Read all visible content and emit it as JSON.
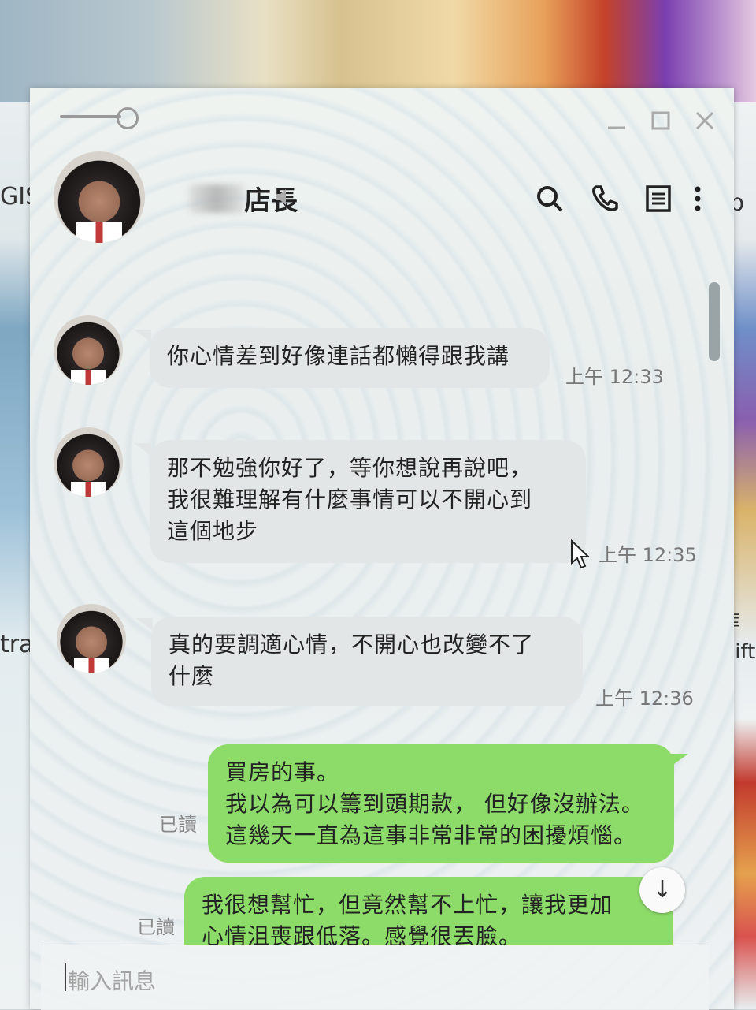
{
  "background": {
    "left_texts": [
      "GIS",
      "trat"
    ],
    "right_texts": [
      "p",
      "库",
      "wift"
    ]
  },
  "contact": {
    "name": "店長"
  },
  "messages": [
    {
      "sender": "contact",
      "lines": [
        "你心情差到好像連話都懶得跟我講"
      ],
      "time": "上午 12:33"
    },
    {
      "sender": "contact",
      "lines": [
        "那不勉強你好了，等你想說再說吧，",
        "我很難理解有什麼事情可以不開心到",
        "這個地步"
      ],
      "time": "上午 12:35"
    },
    {
      "sender": "contact",
      "lines": [
        "真的要調適心情，不開心也改變不了",
        "什麼"
      ],
      "time": "上午 12:36"
    },
    {
      "sender": "me",
      "lines": [
        "買房的事。",
        "我以為可以籌到頭期款， 但好像沒辦法。",
        "這幾天一直為這事非常非常的困擾煩惱。"
      ],
      "status": "已讀"
    },
    {
      "sender": "me",
      "lines": [
        "我很想幫忙，但竟然幫不上忙，讓我更加",
        "心情沮喪跟低落。感覺很丟臉。"
      ],
      "status": "已讀"
    }
  ],
  "input": {
    "placeholder": "輸入訊息"
  },
  "colors": {
    "my_bubble": "#8ddc6a",
    "their_bubble": "#e3e6e7"
  },
  "icons": [
    "pin-icon",
    "minimize-icon",
    "maximize-icon",
    "close-icon",
    "mute-icon",
    "search-icon",
    "phone-icon",
    "notes-icon",
    "more-icon",
    "scroll-down-icon"
  ]
}
